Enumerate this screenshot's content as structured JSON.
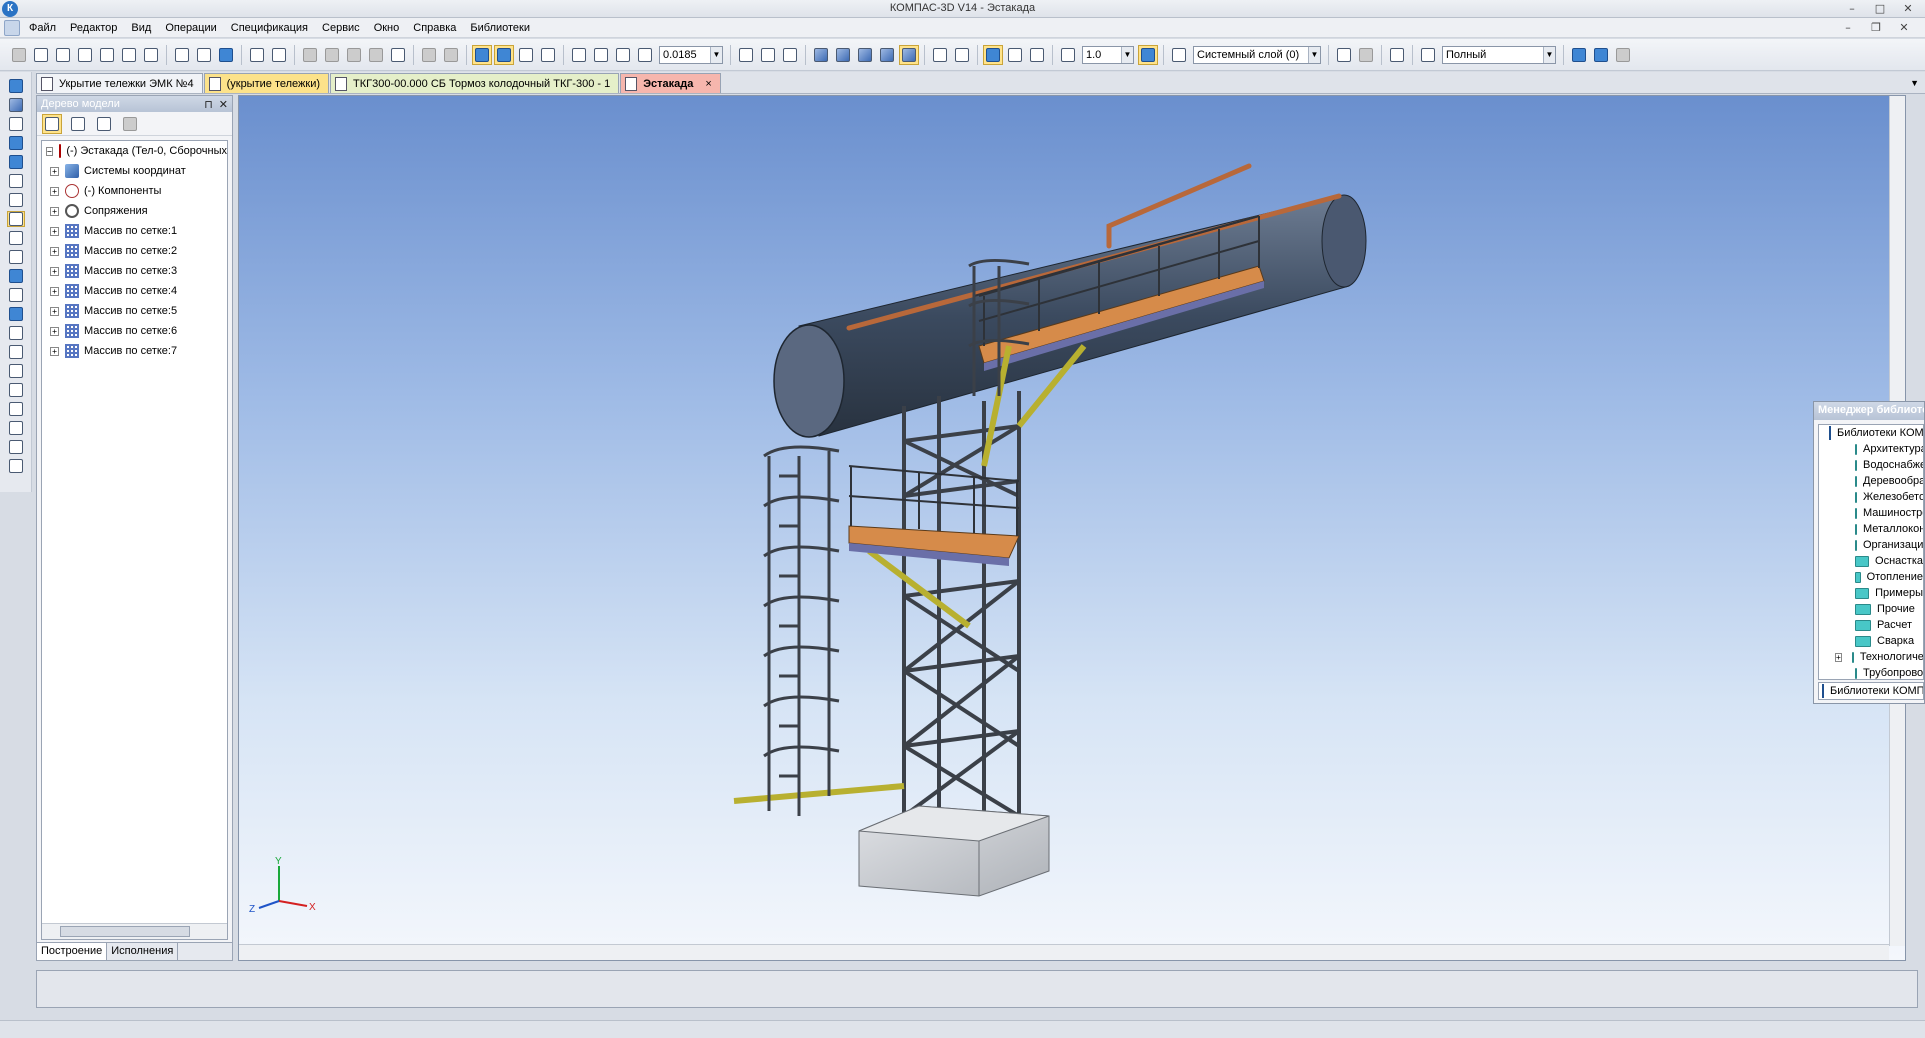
{
  "window": {
    "title": "КОМПАС-3D V14 - Эстакада",
    "app_icon": "К"
  },
  "menu": {
    "items": [
      "Файл",
      "Редактор",
      "Вид",
      "Операции",
      "Спецификация",
      "Сервис",
      "Окно",
      "Справка",
      "Библиотеки"
    ]
  },
  "toolbar": {
    "zoom_value": "0.0185",
    "step_value": "1.0",
    "layer_value": "Системный слой (0)",
    "view_mode_value": "Полный"
  },
  "tabs": [
    {
      "label": "Укрытие тележки ЭМК №4"
    },
    {
      "label": "(укрытие тележки)"
    },
    {
      "label": "ТКГ300-00.000 СБ Тормоз колодочный ТКГ-300 - 1"
    },
    {
      "label": "Эстакада",
      "close": "×"
    }
  ],
  "tree_panel": {
    "title": "Дерево модели",
    "pin": "⊓",
    "close": "✕",
    "nodes": [
      "(-) Эстакада (Тел-0, Сборочных",
      "Системы координат",
      "(-) Компоненты",
      "Сопряжения",
      "Массив по сетке:1",
      "Массив по сетке:2",
      "Массив по сетке:3",
      "Массив по сетке:4",
      "Массив по сетке:5",
      "Массив по сетке:6",
      "Массив по сетке:7"
    ],
    "expand_glyph": "+",
    "bottom_tabs": [
      "Построение",
      "Исполнения"
    ]
  },
  "axes": {
    "x": "X",
    "y": "Y",
    "z": "Z"
  },
  "library_manager": {
    "title": "Менеджер библиотек",
    "root": "Библиотеки КОМПАС",
    "folders": [
      "Архитектура и строительство",
      "Водоснабжение",
      "Деревообработка",
      "Железобетонные конструкции",
      "Машиностроение",
      "Металлоконструкции",
      "Организация строительства",
      "Оснастка",
      "Отопление",
      "Примеры",
      "Прочие",
      "Расчет",
      "Сварка",
      "Технологическая подготовка",
      "Трубопроводы"
    ],
    "expand_glyph": "+",
    "bottom_tab": "Библиотеки КОМПАС"
  },
  "colors": {
    "pipe": "#3b4a5f",
    "steel": "#4a4f57",
    "platform": "#d68b4a",
    "yellow_brace": "#b8b030",
    "foundation": "#c9ccd1",
    "copper": "#b8683a"
  }
}
